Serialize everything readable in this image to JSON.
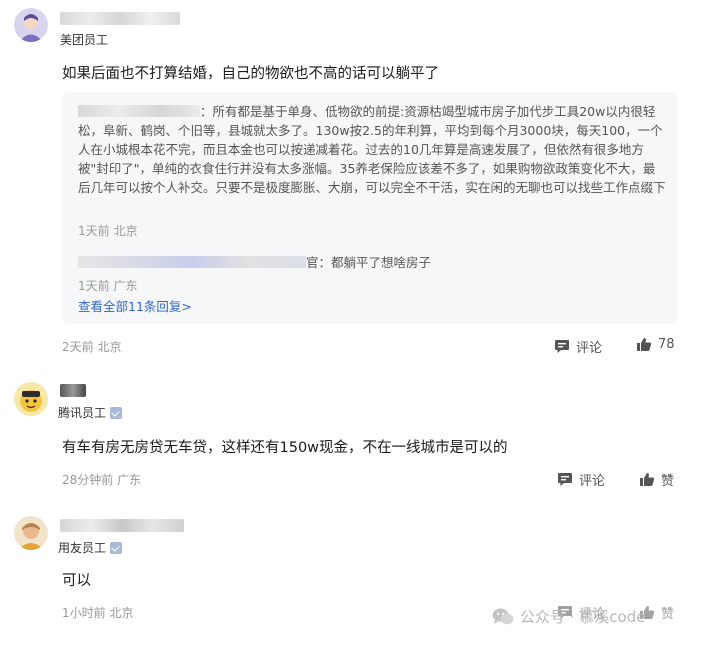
{
  "comments": [
    {
      "role": "美团员工",
      "text": "如果后面也不打算结婚，自己的物欲也不高的话可以躺平了",
      "replies": {
        "reply1_text": "：所有都是基于单身、低物欲的前提:资源枯竭型城市房子加代步工具20w以内很轻松，阜新、鹤岗、个旧等，县城就太多了。130w按2.5的年利算，平均到每个月3000块，每天100，一个人在小城根本花不完，而且本金也可以按递减着花。过去的10几年算是高速发展了，但依然有很多地方被\"封印了\"，单纯的衣食住行并没有太多涨幅。35养老保险应该差不多了，如果购物欲政策变化不大，最后几年可以按个人补交。只要不是极度膨胀、大崩，可以完全不干活，实在闲的无聊也可以找些工作点缀下",
        "reply1_meta": "1天前 北京",
        "reply2_suffix": "官：",
        "reply2_text": "都躺平了想啥房子",
        "reply2_meta": "1天前 广东",
        "view_all": "查看全部11条回复>"
      },
      "meta": "2天前 北京",
      "comment_label": "评论",
      "like_label": "78"
    },
    {
      "role": "腾讯员工",
      "text": "有车有房无房贷无车贷，这样还有150w现金，不在一线城市是可以的",
      "meta": "28分钟前 广东",
      "comment_label": "评论",
      "like_label": "赞"
    },
    {
      "role": "用友员工",
      "text": "可以",
      "meta": "1小时前 北京",
      "comment_label": "评论",
      "like_label": "赞"
    }
  ],
  "watermark": {
    "text": "公众号 · 慕溪code"
  },
  "icons": {
    "comment": "comment-icon",
    "like": "thumbs-up-icon",
    "verified": "verified-badge-icon",
    "wechat": "wechat-icon"
  }
}
